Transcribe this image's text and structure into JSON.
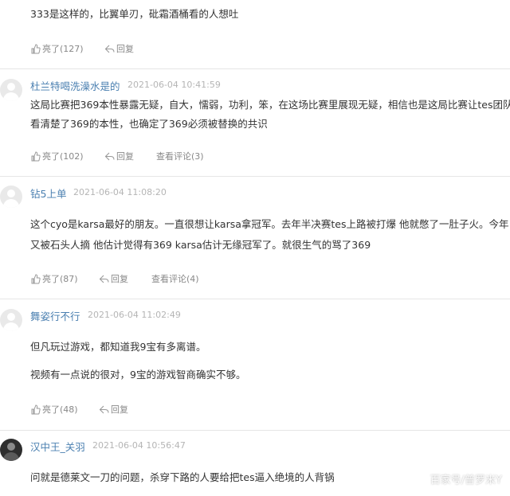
{
  "comments": [
    {
      "user": "",
      "time": "",
      "lines": [
        "333是这样的，比翼单刃，砒霜酒桶看的人想吐"
      ],
      "like": "亮了(127)",
      "reply": "回复",
      "view": ""
    },
    {
      "user": "杜兰特喝洗澡水是的",
      "time": "2021-06-04 10:41:59",
      "lines": [
        "这局比赛把369本性暴露无疑，自大，懦弱，功利，笨，在这场比赛里展现无疑，相信也是这局比赛让tes团队",
        "看清楚了369的本性，也确定了369必须被替换的共识"
      ],
      "like": "亮了(102)",
      "reply": "回复",
      "view": "查看评论(3)"
    },
    {
      "user": "钻5上单",
      "time": "2021-06-04 11:08:20",
      "lines": [
        "这个cyo是karsa最好的朋友。一直很想让karsa拿冠军。去年半决赛tes上路被打爆 他就憋了一肚子火。今年",
        "又被石头人摘 他估计觉得有369 karsa估计无缘冠军了。就很生气的骂了369"
      ],
      "like": "亮了(87)",
      "reply": "回复",
      "view": "查看评论(4)"
    },
    {
      "user": "舞姿行不行",
      "time": "2021-06-04 11:02:49",
      "lines": [
        "但凡玩过游戏，都知道我9宝有多离谱。",
        "视频有一点说的很对，9宝的游戏智商确实不够。"
      ],
      "like": "亮了(48)",
      "reply": "回复",
      "view": ""
    },
    {
      "user": "汉中王_关羽",
      "time": "2021-06-04 10:56:47",
      "lines": [
        "问就是德莱文一刀的问题，杀穿下路的人要给把tes逼入绝境的人背锅"
      ],
      "like": "",
      "reply": "",
      "view": ""
    }
  ],
  "watermark": "百家号/普罗米Y",
  "colors": {
    "username": "#4a7fb0",
    "time": "#b5b5b5",
    "text": "#333333",
    "action": "#888888"
  }
}
